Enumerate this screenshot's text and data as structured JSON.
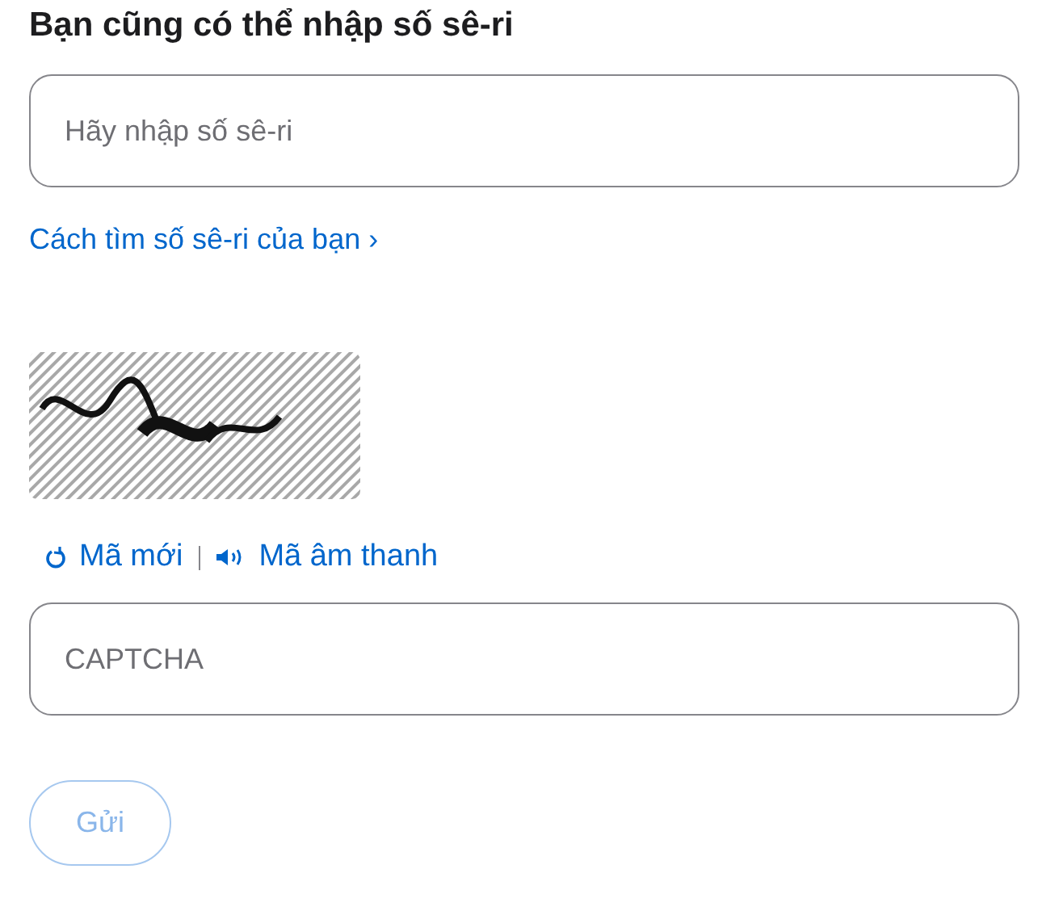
{
  "heading": "Bạn cũng có thể nhập số sê-ri",
  "serial_field": {
    "placeholder": "Hãy nhập số sê-ri"
  },
  "help_link": {
    "label": "Cách tìm số sê-ri của bạn",
    "chevron": "›"
  },
  "captcha_actions": [
    {
      "kind": "refresh",
      "label": "Mã mới"
    },
    {
      "kind": "audio",
      "label": "Mã âm thanh"
    }
  ],
  "captcha_field": {
    "placeholder": "CAPTCHA"
  },
  "submit_button": {
    "label": "Gửi",
    "disabled": true
  }
}
